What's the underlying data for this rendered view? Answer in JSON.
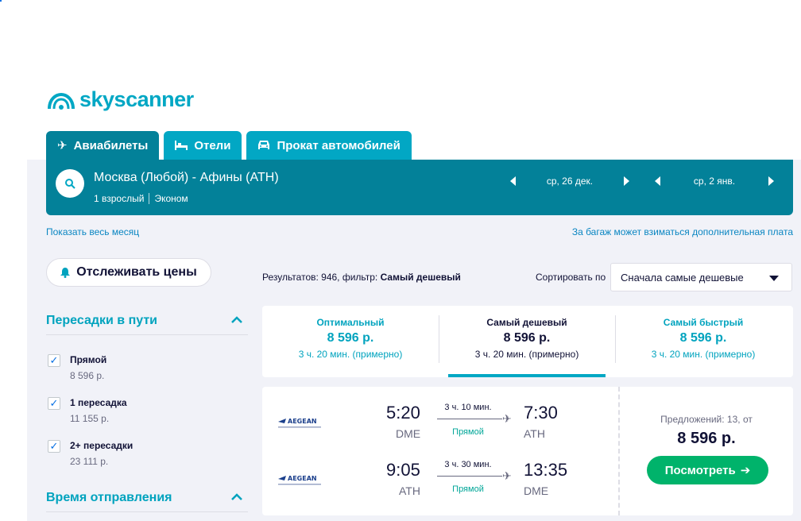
{
  "brand": {
    "name": "skyscanner",
    "color": "#00a7c4"
  },
  "tabs": [
    {
      "label": "Авиабилеты",
      "icon": "plane-icon",
      "active": true
    },
    {
      "label": "Отели",
      "icon": "bed-icon",
      "active": false
    },
    {
      "label": "Прокат автомобилей",
      "icon": "car-icon",
      "active": false
    }
  ],
  "search": {
    "route": "Москва (Любой) - Афины (ATH)",
    "passengers": "1 взрослый",
    "cabin": "Эконом",
    "depart_date": "ср, 26 дек.",
    "return_date": "ср, 2 янв."
  },
  "links": {
    "show_month": "Показать весь месяц",
    "baggage_note": "За багаж может взиматься дополнительная плата"
  },
  "track_prices": "Отслеживать цены",
  "filters": {
    "stops_title": "Пересадки в пути",
    "stops": [
      {
        "label": "Прямой",
        "price": "8 596 р.",
        "checked": true
      },
      {
        "label": "1 пересадка",
        "price": "11 155 р.",
        "checked": true
      },
      {
        "label": "2+ пересадки",
        "price": "23 111 р.",
        "checked": true
      }
    ],
    "departure_title": "Время отправления"
  },
  "results": {
    "prefix": "Результатов: 946, фильтр: ",
    "filter_name": "Самый дешевый",
    "sort_label": "Сортировать по",
    "sort_value": "Сначала самые дешевые"
  },
  "sort_tabs": [
    {
      "title": "Оптимальный",
      "price": "8 596 р.",
      "duration": "3 ч. 20 мин. (примерно)"
    },
    {
      "title": "Самый дешевый",
      "price": "8 596 р.",
      "duration": "3 ч. 20 мин. (примерно)"
    },
    {
      "title": "Самый быстрый",
      "price": "8 596 р.",
      "duration": "3 ч. 20 мин. (примерно)"
    }
  ],
  "ticket": {
    "legs": [
      {
        "airline": "AEGEAN",
        "dep_time": "5:20",
        "dep_code": "DME",
        "duration": "3 ч. 10 мин.",
        "stops": "Прямой",
        "arr_time": "7:30",
        "arr_code": "ATH"
      },
      {
        "airline": "AEGEAN",
        "dep_time": "9:05",
        "dep_code": "ATH",
        "duration": "3 ч. 30 мин.",
        "stops": "Прямой",
        "arr_time": "13:35",
        "arr_code": "DME"
      }
    ],
    "offers": "Предложений: 13, от",
    "price": "8 596 р.",
    "view_button": "Посмотреть"
  }
}
